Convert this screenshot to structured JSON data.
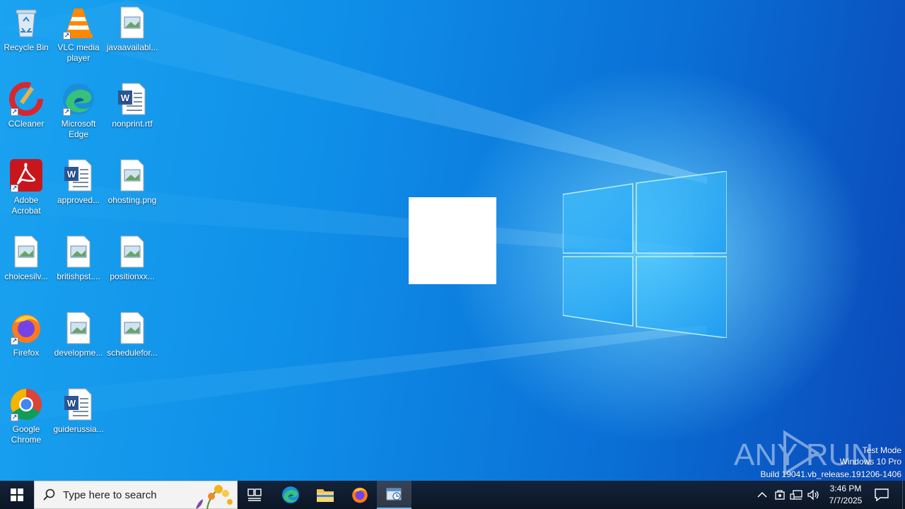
{
  "desktop": {
    "icons": [
      {
        "label": "Recycle Bin",
        "icon": "recycle-bin-icon"
      },
      {
        "label": "VLC media player",
        "icon": "vlc-icon",
        "shortcut": true
      },
      {
        "label": "javaavailabl...",
        "icon": "image-file-icon"
      },
      {
        "label": "CCleaner",
        "icon": "ccleaner-icon",
        "shortcut": true
      },
      {
        "label": "Microsoft Edge",
        "icon": "edge-icon",
        "shortcut": true
      },
      {
        "label": "nonprint.rtf",
        "icon": "word-doc-icon"
      },
      {
        "label": "Adobe Acrobat",
        "icon": "acrobat-icon",
        "shortcut": true
      },
      {
        "label": "approved...",
        "icon": "word-doc-icon"
      },
      {
        "label": "ohosting.png",
        "icon": "image-file-icon"
      },
      {
        "label": "choicesilv...",
        "icon": "image-file-icon"
      },
      {
        "label": "britishpst....",
        "icon": "image-file-icon"
      },
      {
        "label": "positionxx...",
        "icon": "image-file-icon"
      },
      {
        "label": "Firefox",
        "icon": "firefox-icon",
        "shortcut": true
      },
      {
        "label": "developme...",
        "icon": "image-file-icon"
      },
      {
        "label": "schedulefor...",
        "icon": "image-file-icon"
      },
      {
        "label": "Google Chrome",
        "icon": "chrome-icon",
        "shortcut": true
      },
      {
        "label": "guiderussia...",
        "icon": "word-doc-icon"
      }
    ]
  },
  "watermark": {
    "brand": "ANY RUN",
    "line1": "Test Mode",
    "line2": "Windows 10 Pro",
    "line3": "Build 19041.vb_release.191206-1406"
  },
  "taskbar": {
    "search_placeholder": "Type here to search",
    "pinned": [
      "edge-icon",
      "file-explorer-icon",
      "firefox-icon",
      "active-app-icon"
    ],
    "clock": {
      "time": "3:46 PM",
      "date": "7/7/2025"
    }
  },
  "colors": {
    "accent": "#0078d7",
    "taskbar": "#0e1a2b",
    "active_underline": "#76b9ed"
  }
}
